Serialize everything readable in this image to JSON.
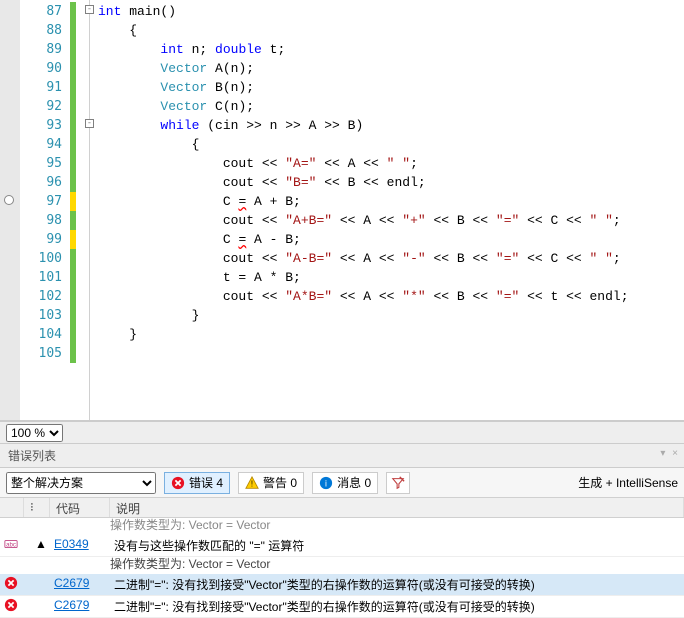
{
  "code": {
    "lines": [
      {
        "n": 87,
        "html": "<span class='kw'>int</span> main()"
      },
      {
        "n": 88,
        "html": "    {"
      },
      {
        "n": 89,
        "html": "        <span class='kw'>int</span> n; <span class='kw'>double</span> t;"
      },
      {
        "n": 90,
        "html": "        <span class='typ'>Vector</span> A(n);"
      },
      {
        "n": 91,
        "html": "        <span class='typ'>Vector</span> B(n);"
      },
      {
        "n": 92,
        "html": "        <span class='typ'>Vector</span> C(n);"
      },
      {
        "n": 93,
        "html": "        <span class='kw'>while</span> (cin &gt;&gt; n &gt;&gt; A &gt;&gt; B)"
      },
      {
        "n": 94,
        "html": "            {"
      },
      {
        "n": 95,
        "html": "                cout &lt;&lt; <span class='str'>\"A=\"</span> &lt;&lt; A &lt;&lt; <span class='str'>\" \"</span>;"
      },
      {
        "n": 96,
        "html": "                cout &lt;&lt; <span class='str'>\"B=\"</span> &lt;&lt; B &lt;&lt; endl;"
      },
      {
        "n": 97,
        "html": "                C <span style='text-decoration:underline wavy red'>=</span> A + B;"
      },
      {
        "n": 98,
        "html": "                cout &lt;&lt; <span class='str'>\"A+B=\"</span> &lt;&lt; A &lt;&lt; <span class='str'>\"+\"</span> &lt;&lt; B &lt;&lt; <span class='str'>\"=\"</span> &lt;&lt; C &lt;&lt; <span class='str'>\" \"</span>;"
      },
      {
        "n": 99,
        "html": "                C <span style='text-decoration:underline wavy red'>=</span> A - B;"
      },
      {
        "n": 100,
        "html": "                cout &lt;&lt; <span class='str'>\"A-B=\"</span> &lt;&lt; A &lt;&lt; <span class='str'>\"-\"</span> &lt;&lt; B &lt;&lt; <span class='str'>\"=\"</span> &lt;&lt; C &lt;&lt; <span class='str'>\" \"</span>;"
      },
      {
        "n": 101,
        "html": "                t = A * B;"
      },
      {
        "n": 102,
        "html": "                cout &lt;&lt; <span class='str'>\"A*B=\"</span> &lt;&lt; A &lt;&lt; <span class='str'>\"*\"</span> &lt;&lt; B &lt;&lt; <span class='str'>\"=\"</span> &lt;&lt; t &lt;&lt; endl;"
      },
      {
        "n": 103,
        "html": "            }"
      },
      {
        "n": 104,
        "html": "    }"
      },
      {
        "n": 105,
        "html": ""
      }
    ],
    "outline_boxes": [
      {
        "line": 87,
        "sym": "-"
      },
      {
        "line": 93,
        "sym": "-"
      }
    ],
    "change_marks": [
      {
        "from": 87,
        "to": 105,
        "kind": "green"
      },
      {
        "from": 97,
        "to": 97,
        "kind": "yellow"
      },
      {
        "from": 99,
        "to": 99,
        "kind": "yellow"
      }
    ],
    "breakpoint_hover_line": 97
  },
  "zoom": {
    "value": "100 %"
  },
  "error_list": {
    "title": "错误列表",
    "scope_selected": "整个解决方案",
    "tabs": {
      "errors": {
        "label": "错误",
        "count": 4
      },
      "warnings": {
        "label": "警告",
        "count": 0
      },
      "messages": {
        "label": "消息",
        "count": 0
      }
    },
    "generate_label": "生成 + IntelliSense",
    "columns": {
      "code": "代码",
      "desc": "说明"
    },
    "rows": [
      {
        "icon": "intellisense",
        "state": "expand",
        "code": "E0349",
        "desc": "没有与这些操作数匹配的 \"=\" 运算符",
        "sub": "操作数类型为: Vector = Vector"
      },
      {
        "icon": "error",
        "code": "C2679",
        "desc": "二进制\"=\": 没有找到接受\"Vector\"类型的右操作数的运算符(或没有可接受的转换)",
        "sel": true
      },
      {
        "icon": "error",
        "code": "C2679",
        "desc": "二进制\"=\": 没有找到接受\"Vector\"类型的右操作数的运算符(或没有可接受的转换)"
      }
    ],
    "truncated_top": "操作数类型为: Vector = Vector"
  }
}
